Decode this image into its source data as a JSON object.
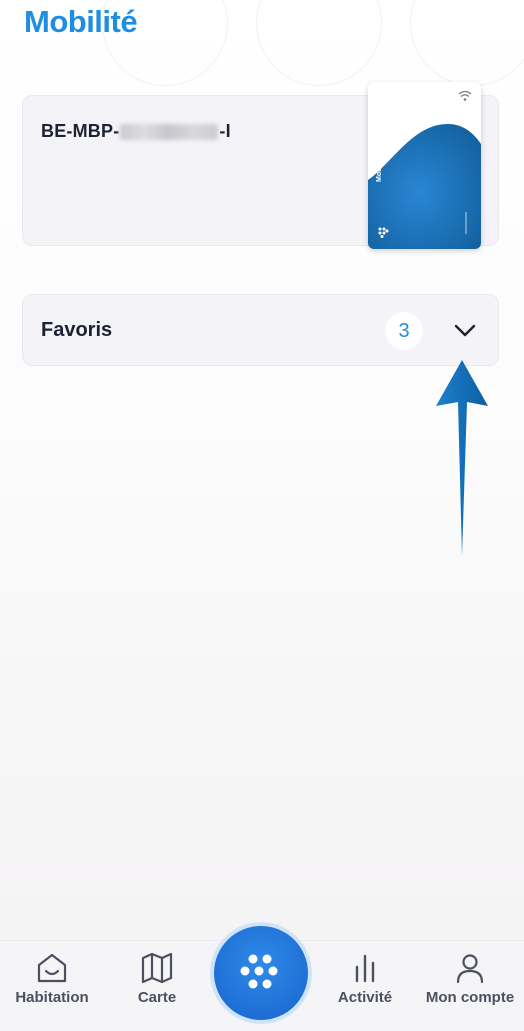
{
  "header": {
    "title": "Mobilité"
  },
  "card": {
    "id_prefix": "BE-MBP-",
    "id_suffix": "-I",
    "brand": "MobilityPlus"
  },
  "favorites": {
    "label": "Favoris",
    "count": "3"
  },
  "tabbar": {
    "items": [
      {
        "label": "Habitation",
        "icon": "home-icon"
      },
      {
        "label": "Carte",
        "icon": "map-icon"
      },
      {
        "label": "",
        "icon": "mobility-plus-logo-icon"
      },
      {
        "label": "Activité",
        "icon": "bar-chart-icon"
      },
      {
        "label": "Mon compte",
        "icon": "user-icon"
      }
    ]
  },
  "colors": {
    "accent": "#1f8ee0",
    "card_blue": "#1a73b8",
    "fab_blue": "#1f6fd6",
    "annotation_arrow": "#1272c0"
  }
}
